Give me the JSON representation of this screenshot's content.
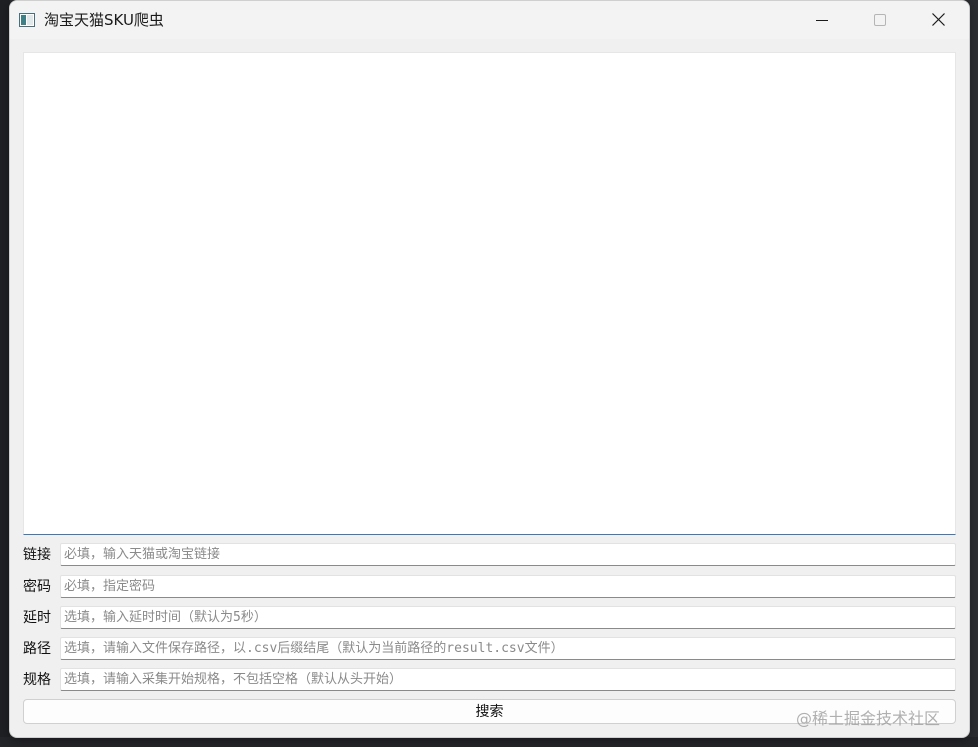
{
  "window": {
    "title": "淘宝天猫SKU爬虫",
    "app_icon": "window-app-icon",
    "controls": {
      "minimize_icon": "minimize-icon",
      "maximize_icon": "maximize-icon",
      "close_icon": "close-icon"
    }
  },
  "output": {
    "text": ""
  },
  "form": {
    "link": {
      "label": "链接",
      "placeholder": "必填，输入天猫或淘宝链接",
      "value": ""
    },
    "password": {
      "label": "密码",
      "placeholder": "必填，指定密码",
      "value": ""
    },
    "delay": {
      "label": "延时",
      "placeholder": "选填，输入延时时间（默认为5秒）",
      "value": ""
    },
    "path": {
      "label": "路径",
      "placeholder": "选填，请输入文件保存路径，以.csv后缀结尾（默认为当前路径的result.csv文件）",
      "value": ""
    },
    "spec": {
      "label": "规格",
      "placeholder": "选填，请输入采集开始规格，不包括空格（默认从头开始）",
      "value": ""
    }
  },
  "search_button": {
    "label": "搜索"
  },
  "watermark": {
    "text": "@稀土掘金技术社区"
  }
}
